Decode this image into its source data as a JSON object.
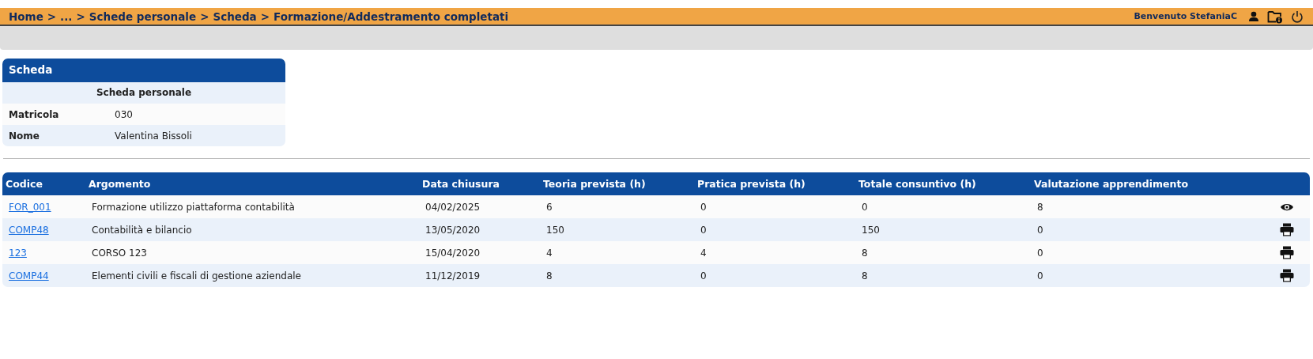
{
  "breadcrumb": [
    "Home",
    "...",
    "Schede personale",
    "Scheda",
    "Formazione/Addestramento completati"
  ],
  "breadcrumb_separator": ">",
  "user": {
    "greeting": "Benvenuto StefaniaC"
  },
  "card": {
    "title": "Scheda",
    "subtitle": "Scheda personale",
    "fields": [
      {
        "label": "Matricola",
        "value": "030"
      },
      {
        "label": "Nome",
        "value": "Valentina Bissoli"
      }
    ]
  },
  "table": {
    "columns": [
      "Codice",
      "Argomento",
      "Data chiusura",
      "Teoria prevista (h)",
      "Pratica prevista (h)",
      "Totale consuntivo (h)",
      "Valutazione apprendimento"
    ],
    "rows": [
      {
        "cells": [
          "FOR_001",
          "Formazione utilizzo piattaforma contabilità",
          "04/02/2025",
          "6",
          "0",
          "0",
          "8"
        ],
        "kind": "view"
      },
      {
        "cells": [
          "COMP48",
          "Contabilità e bilancio",
          "13/05/2020",
          "150",
          "0",
          "150",
          "0"
        ],
        "kind": "print"
      },
      {
        "cells": [
          "123",
          "CORSO 123",
          "15/04/2020",
          "4",
          "4",
          "8",
          "0"
        ],
        "kind": "print"
      },
      {
        "cells": [
          "COMP44",
          "Elementi civili e fiscali di gestione aziendale",
          "11/12/2019",
          "8",
          "0",
          "8",
          "0"
        ],
        "kind": "print"
      }
    ]
  }
}
